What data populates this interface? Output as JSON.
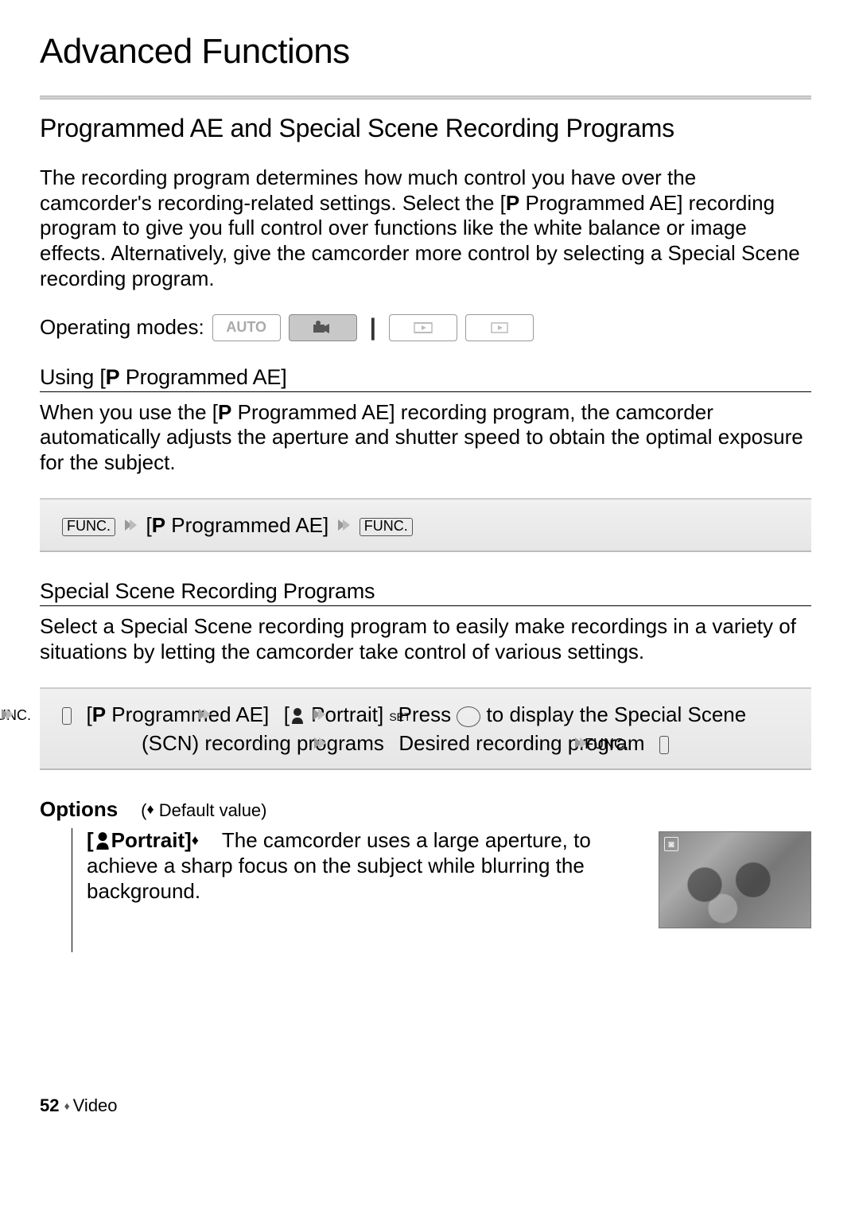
{
  "chapter_title": "Advanced Functions",
  "section_heading": "Programmed AE and Special Scene Recording Programs",
  "intro_before": "The recording program determines how much control you have over the camcorder's recording-related settings. Select the [",
  "intro_prog": " Programmed AE] recording program to give you full control over functions like the white balance or image effects. Alternatively, give the camcorder more control by selecting a Special Scene recording program.",
  "operating_modes_label": "Operating modes:",
  "modes": {
    "auto": "AUTO"
  },
  "using_heading_prefix": "Using [",
  "using_heading_suffix": " Programmed AE]",
  "using_body_before": "When you use the [",
  "using_body_after": " Programmed AE] recording program, the cam­corder automatically adjusts the aperture and shutter speed to obtain the optimal exposure for the subject.",
  "func_label": "FUNC.",
  "set_label": "SET",
  "step1_middle": " Programmed AE]",
  "scn_heading": "Special Scene Recording Programs",
  "scn_body": "Select a Special Scene recording program to easily make recordings in a variety of situations by letting the camcorder take control of various settings.",
  "step2_prog": " Programmed AE]",
  "step2_portrait": " Portrait]",
  "step2_press": "Press ",
  "step2_to": " to",
  "step2_line2": "display the Special Scene (SCN) recording programs",
  "step2_line3": "Desired recording program",
  "options_label": "Options",
  "default_note": " Default value)",
  "portrait_label": "Portrait]",
  "portrait_desc": "The camcorder uses a large aper­ture, to achieve a sharp focus on the subject while blurring the background.",
  "footer_page": "52",
  "footer_section": "Video"
}
